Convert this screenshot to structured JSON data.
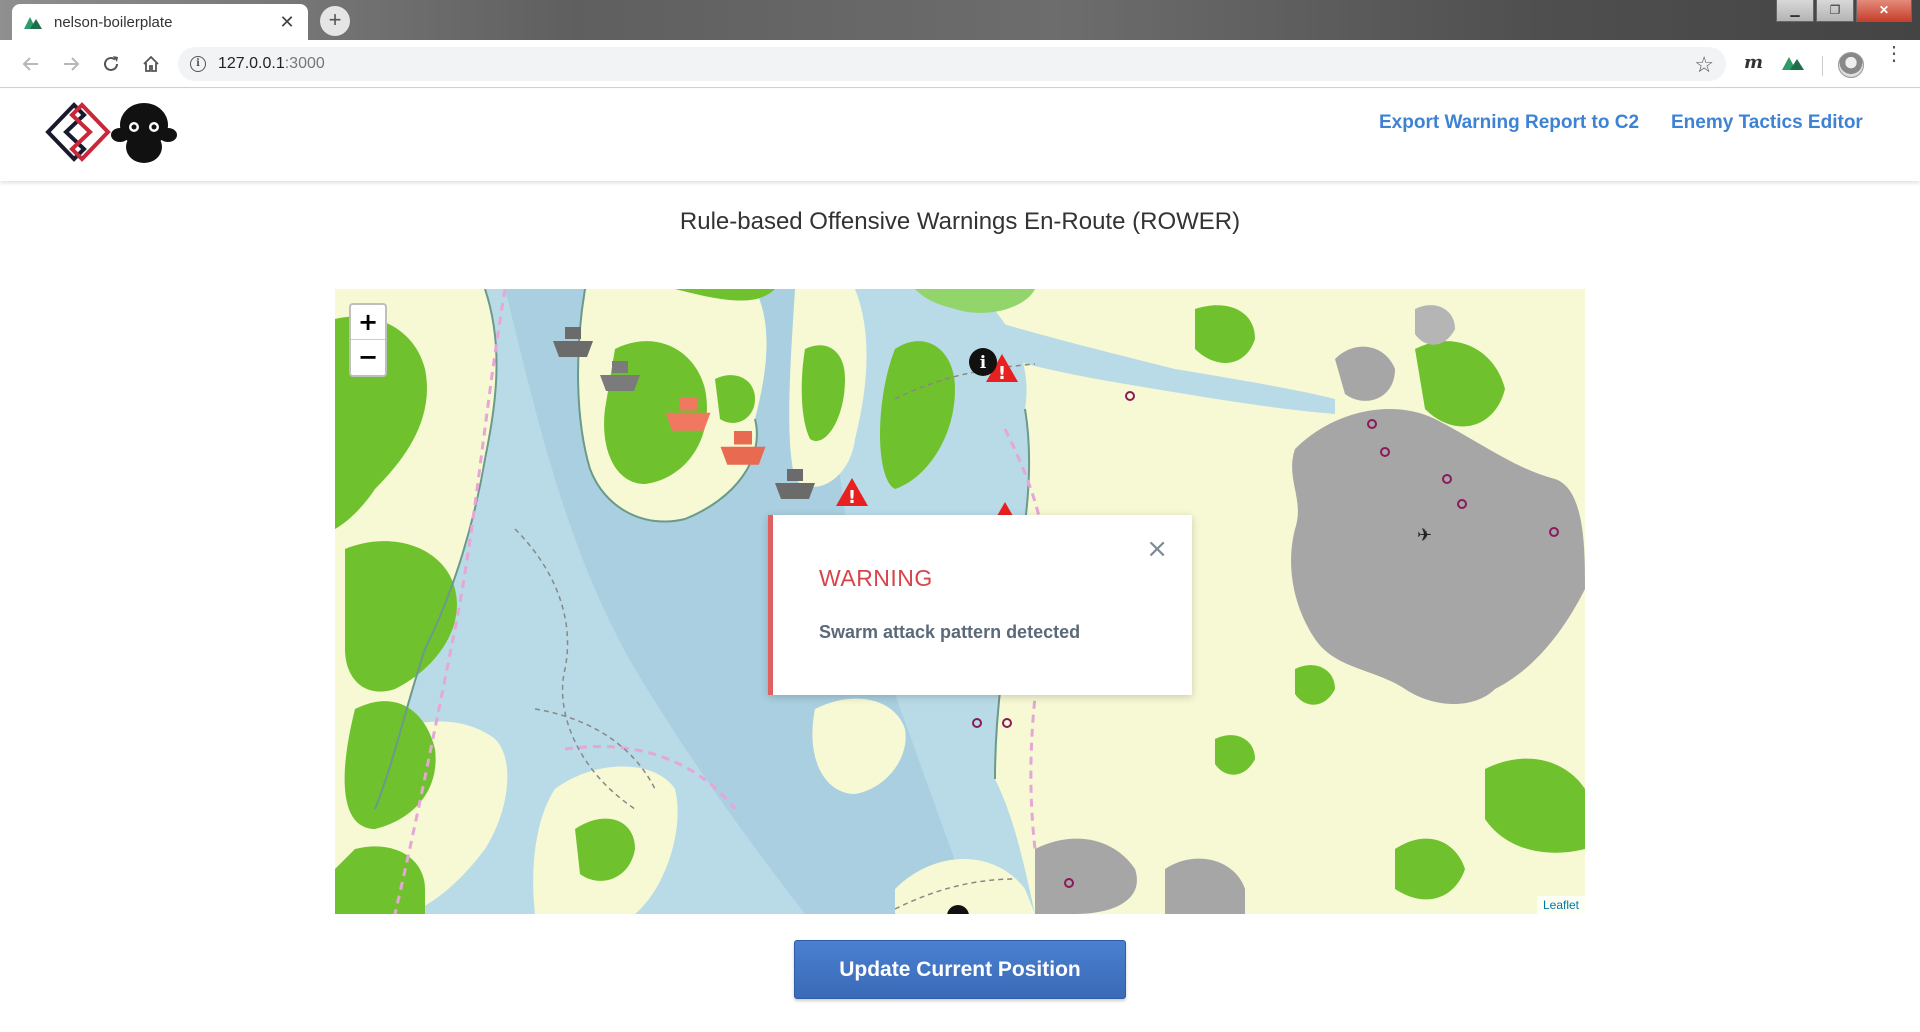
{
  "browser": {
    "tab_title": "nelson-boilerplate",
    "tab_close": "✕",
    "new_tab": "+",
    "url_host": "127.0.0.1",
    "url_port": ":3000",
    "window_controls": {
      "minimize": "▁",
      "maximize": "❐",
      "close": "✕"
    }
  },
  "nav": {
    "links": [
      {
        "label": "Export Warning Report to C2"
      },
      {
        "label": "Enemy Tactics Editor"
      }
    ]
  },
  "page": {
    "title": "Rule-based Offensive Warnings En-Route (ROWER)"
  },
  "map": {
    "zoom_in": "+",
    "zoom_out": "−",
    "attribution": "Leaflet",
    "markers": [
      {
        "type": "ship",
        "color": "#6b6b6b"
      },
      {
        "type": "ship",
        "color": "#6b6b6b"
      },
      {
        "type": "ship",
        "color": "#f07860"
      },
      {
        "type": "ship",
        "color": "#f07860"
      },
      {
        "type": "ship",
        "color": "#6b6b6b"
      },
      {
        "type": "warning",
        "color": "#e82020"
      },
      {
        "type": "warning",
        "color": "#e82020"
      },
      {
        "type": "warning",
        "color": "#e82020"
      },
      {
        "type": "info",
        "color": "#111111"
      }
    ]
  },
  "warning": {
    "title": "WARNING",
    "message": "Swarm attack pattern detected",
    "close": "×"
  },
  "actions": {
    "update_label": "Update Current Position"
  },
  "colors": {
    "link": "#3e82d4",
    "warning_red": "#d6454a",
    "button_blue": "#3a6ab8",
    "water": "#b9dbe8",
    "land": "#f7f9d4",
    "forest": "#6fc22e",
    "urban": "#a6a6a6"
  }
}
